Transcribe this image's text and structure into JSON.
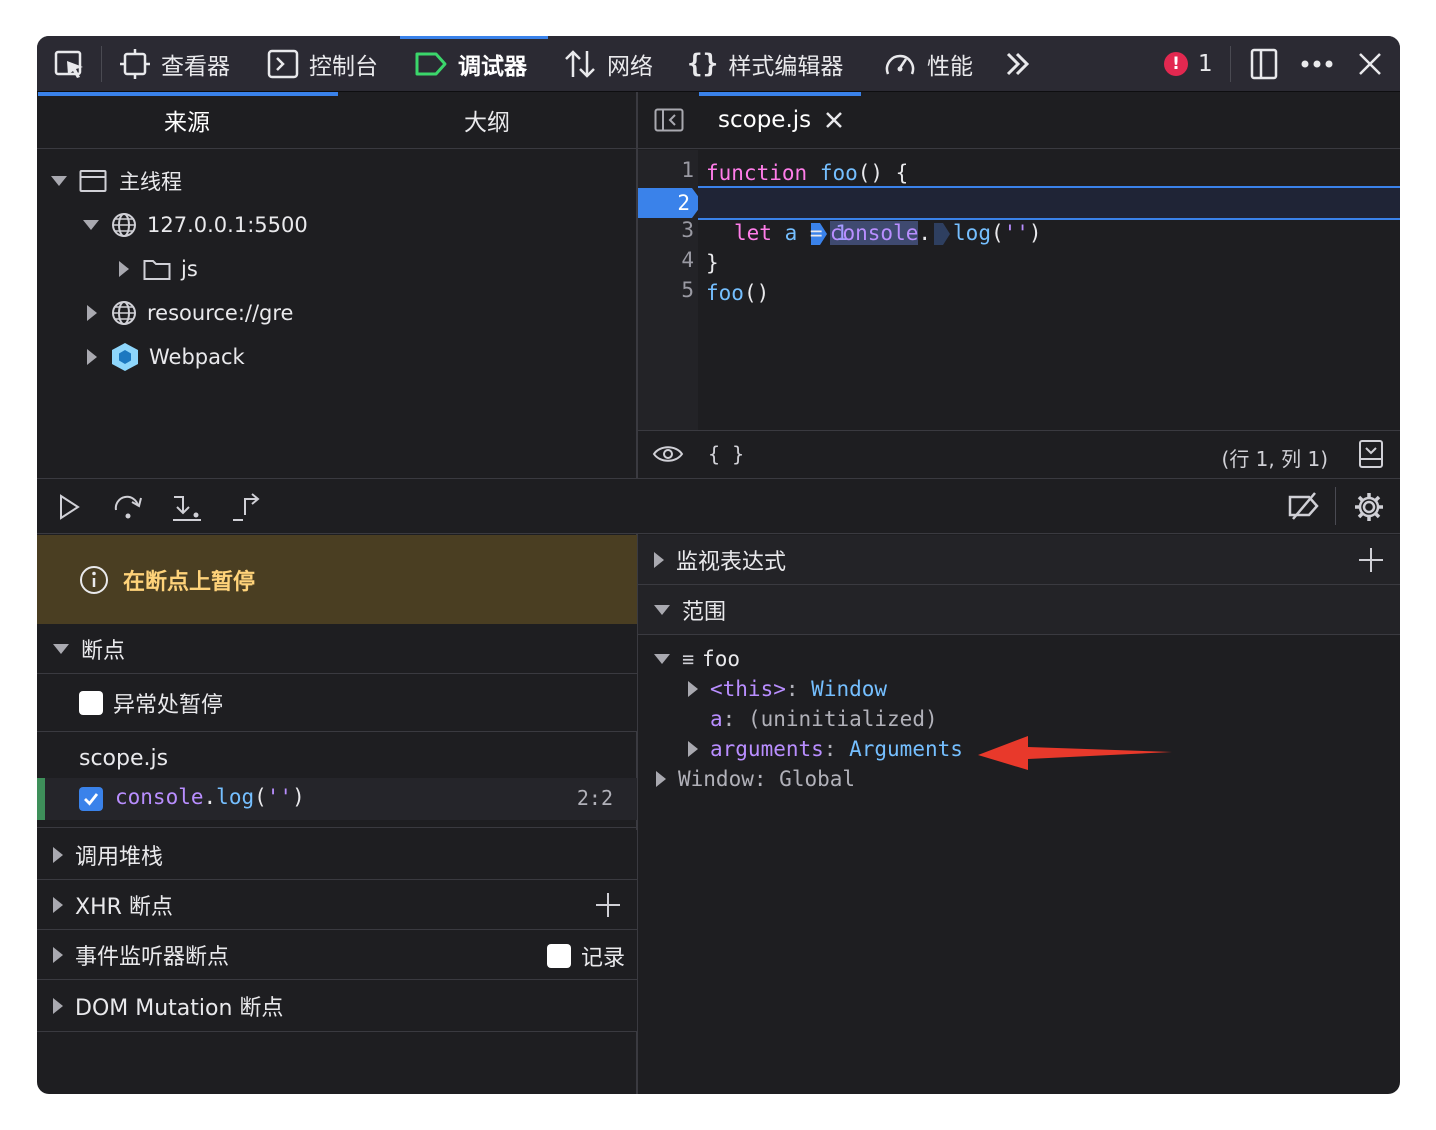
{
  "toolbar": {
    "tabs": [
      {
        "label": "查看器"
      },
      {
        "label": "控制台"
      },
      {
        "label": "调试器"
      },
      {
        "label": "网络"
      },
      {
        "label": "样式编辑器"
      },
      {
        "label": "性能"
      }
    ],
    "error_count": "1"
  },
  "sources_pane": {
    "tabs": [
      "来源",
      "大纲"
    ],
    "tree": [
      {
        "label": "主线程"
      },
      {
        "label": "127.0.0.1:5500"
      },
      {
        "label": "js"
      },
      {
        "label": "resource://gre"
      },
      {
        "label": "Webpack"
      }
    ]
  },
  "editor": {
    "tab_label": "scope.js",
    "line_numbers": [
      "1",
      "2",
      "3",
      "4",
      "5"
    ],
    "lines": {
      "l1_kw": "function",
      "l1_fn": "foo",
      "l1_rest": "() {",
      "l2_obj": "console",
      "l2_dot": ".",
      "l2_fn": "log",
      "l2_open": "(",
      "l2_str": "''",
      "l2_close": ")",
      "l3_kw": "let",
      "l3_var": "a",
      "l3_eq": "=",
      "l3_num": "1",
      "l4": "}",
      "l5_fn": "foo",
      "l5_rest": "()"
    },
    "footer_braces": "{ }",
    "cursor_position": "(行 1, 列 1)"
  },
  "debugger": {
    "paused_message": "在断点上暂停",
    "breakpoints_title": "断点",
    "pause_on_exceptions": "异常处暂停",
    "bp_file": "scope.js",
    "bp_code_obj": "console",
    "bp_code_dot": ".",
    "bp_code_fn": "log",
    "bp_code_args_open": "(",
    "bp_code_str": "''",
    "bp_code_args_close": ")",
    "bp_location": "2:2",
    "call_stack": "调用堆栈",
    "xhr_breakpoints": "XHR 断点",
    "event_listener_breakpoints": "事件监听器断点",
    "log_label": "记录",
    "dom_mutation": "DOM Mutation 断点"
  },
  "right_panel": {
    "watch_expressions": "监视表达式",
    "scopes": "范围",
    "scope_tree": {
      "foo_label": "foo",
      "this_key": "<this>",
      "this_colon": ":",
      "this_value": "Window",
      "a_key": "a",
      "a_colon": ":",
      "a_value": "(uninitialized)",
      "arguments_key": "arguments",
      "arguments_colon": ":",
      "arguments_value": "Arguments",
      "window_key": "Window",
      "window_colon": ":",
      "window_value": "Global"
    }
  },
  "colors": {
    "accent": "#3a82ea",
    "annotation_arrow": "#e8392b",
    "paused_bg": "#4a3e22"
  }
}
